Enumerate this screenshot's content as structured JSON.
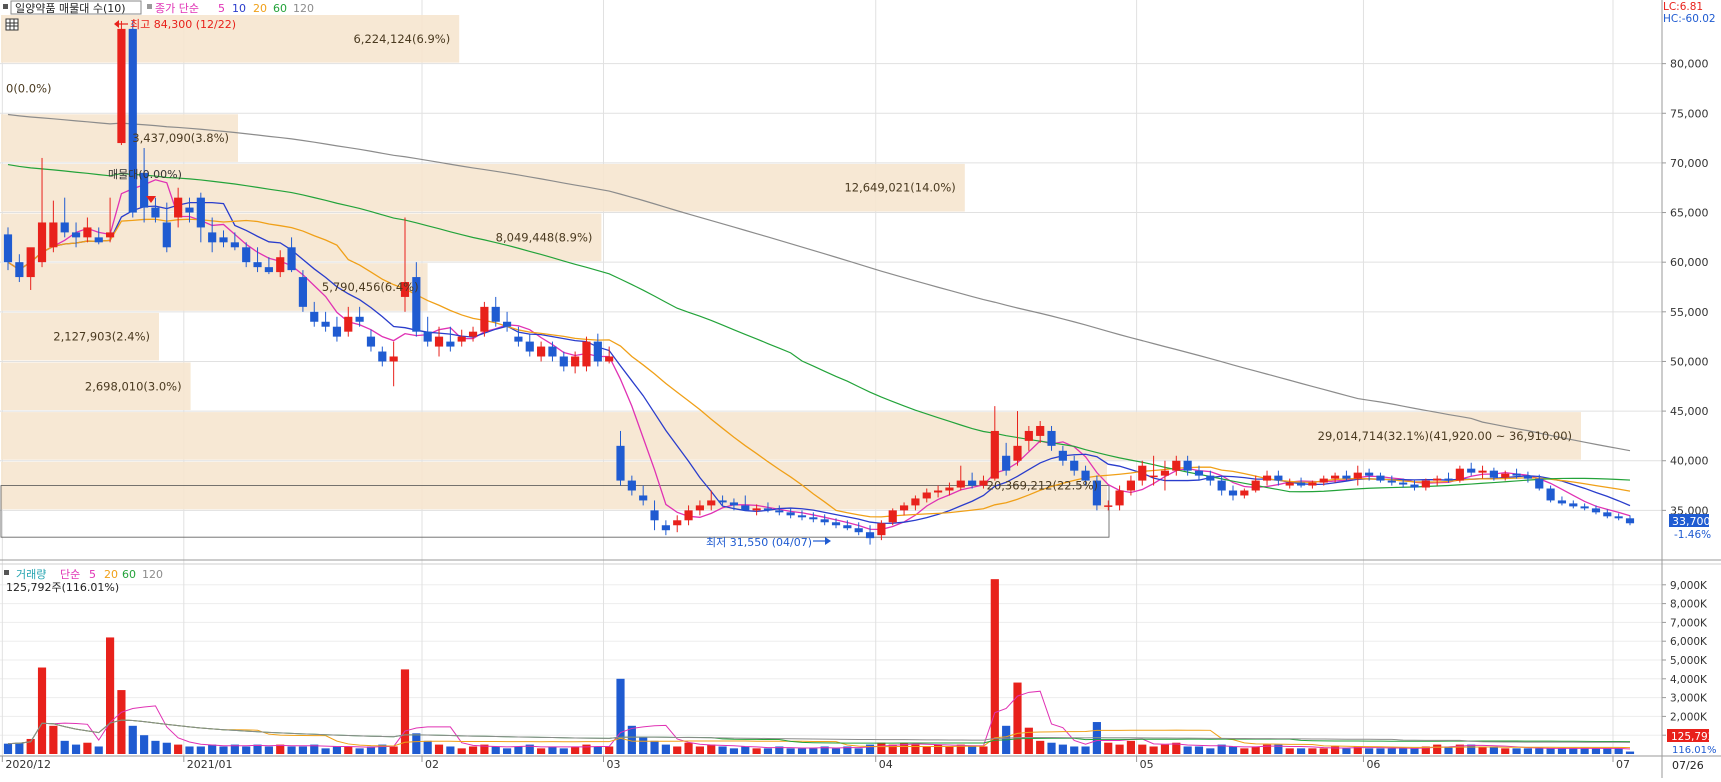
{
  "header": {
    "title": "일양약품 매물대 수(10)",
    "ma_prefix": "종가 단순",
    "ma_periods": [
      "5",
      "10",
      "20",
      "60",
      "120"
    ],
    "lc_label": "LC:6.81",
    "hc_label": "HC:-60.02"
  },
  "volume_header": {
    "title": "거래량",
    "ma_prefix": "단순",
    "ma_periods": [
      "5",
      "20",
      "60",
      "120"
    ],
    "current_value": "125,792주(116.01%)"
  },
  "colors": {
    "up": "#e8211b",
    "down": "#1f5bd1",
    "ma5": "#e032b4",
    "ma10": "#2a3dcc",
    "ma20": "#f0a018",
    "ma60": "#23a33a",
    "ma120": "#8c8c8c",
    "profile": "#f6e5cf"
  },
  "price_axis": {
    "ticks": [
      "35,000",
      "40,000",
      "45,000",
      "50,000",
      "55,000",
      "60,000",
      "65,000",
      "70,000",
      "75,000",
      "80,000"
    ],
    "current_price": "33,700",
    "change_pct": "-1.46%"
  },
  "volume_axis": {
    "ticks": [
      "1,000K",
      "2,000K",
      "3,000K",
      "4,000K",
      "5,000K",
      "6,000K",
      "7,000K",
      "8,000K",
      "9,000K"
    ],
    "current_volume": "125,792",
    "pct_label": "116.01%"
  },
  "time_axis": {
    "labels": [
      "2020/12",
      "2021/01",
      "02",
      "03",
      "04",
      "05",
      "06",
      "07"
    ],
    "last_date": "07/26"
  },
  "annotations": {
    "high": "최고 84,300 (12/22)",
    "low": "최저 31,550 (04/07)"
  },
  "chart_data": {
    "type": "candlestick",
    "title": "일양약품 매물대 수(10)",
    "price_range": [
      30000,
      85000
    ],
    "volume_range": [
      0,
      10000000
    ],
    "volume_profile": [
      {
        "label": "6,224,124(6.9%)",
        "from": 80000,
        "to": 85000
      },
      {
        "label": "0(0.0%)",
        "from": 75000,
        "to": 80000
      },
      {
        "label": "3,437,090(3.8%)",
        "from": 70000,
        "to": 75000
      },
      {
        "label": "12,649,021(14.0%)",
        "from": 65000,
        "to": 70000
      },
      {
        "label": "8,049,448(8.9%)",
        "from": 60000,
        "to": 65000
      },
      {
        "label": "5,790,456(6.4%)",
        "from": 55000,
        "to": 60000
      },
      {
        "label": "2,127,903(2.4%)",
        "from": 50000,
        "to": 55000
      },
      {
        "label": "2,698,010(3.0%)",
        "from": 45000,
        "to": 50000
      },
      {
        "label": "29,014,714(32.1%)(41,920.00 ~ 36,910.00)",
        "from": 40000,
        "to": 45000
      },
      {
        "label": "20,369,212(22.5%)",
        "from": 35000,
        "to": 40000
      }
    ],
    "profile_lengths": [
      0.29,
      0,
      0.15,
      0.61,
      0.38,
      0.27,
      0.1,
      0.12,
      1.0,
      0.7
    ],
    "mid_label": "매물대(0.00%)",
    "candles": [
      [
        62800,
        63500,
        59200,
        60000,
        0.55
      ],
      [
        60000,
        60800,
        58000,
        58500,
        0.6
      ],
      [
        58500,
        61000,
        57200,
        61500,
        0.8
      ],
      [
        60000,
        70500,
        59500,
        64000,
        4.6
      ],
      [
        61500,
        66200,
        61000,
        64000,
        1.5
      ],
      [
        64000,
        66500,
        62500,
        63000,
        0.7
      ],
      [
        63000,
        64000,
        61500,
        62500,
        0.5
      ],
      [
        62500,
        64500,
        62000,
        63500,
        0.6
      ],
      [
        62500,
        63500,
        61800,
        62000,
        0.4
      ],
      [
        62500,
        66500,
        62000,
        63000,
        6.2
      ],
      [
        72000,
        84300,
        71800,
        83500,
        3.4
      ],
      [
        83500,
        84300,
        64500,
        65000,
        1.5
      ],
      [
        69000,
        71500,
        64000,
        65500,
        1.0
      ],
      [
        65500,
        66500,
        64000,
        64500,
        0.7
      ],
      [
        64000,
        66000,
        61000,
        61500,
        0.6
      ],
      [
        64500,
        67500,
        63500,
        66500,
        0.5
      ],
      [
        65500,
        66500,
        64000,
        65000,
        0.4
      ],
      [
        66500,
        67000,
        62000,
        63500,
        0.4
      ],
      [
        63000,
        64500,
        61000,
        62000,
        0.5
      ],
      [
        62500,
        63200,
        61500,
        62000,
        0.4
      ],
      [
        62000,
        63000,
        61200,
        61500,
        0.5
      ],
      [
        61500,
        62000,
        59500,
        60000,
        0.4
      ],
      [
        60000,
        61500,
        59000,
        59500,
        0.5
      ],
      [
        59500,
        60500,
        58800,
        59000,
        0.4
      ],
      [
        59000,
        61200,
        58500,
        60500,
        0.5
      ],
      [
        61500,
        62500,
        59000,
        59200,
        0.4
      ],
      [
        58500,
        59200,
        55000,
        55500,
        0.4
      ],
      [
        55000,
        56000,
        53500,
        54000,
        0.5
      ],
      [
        54000,
        55000,
        53000,
        53500,
        0.3
      ],
      [
        53500,
        54500,
        52000,
        52500,
        0.4
      ],
      [
        53000,
        55500,
        52500,
        54500,
        0.4
      ],
      [
        54500,
        55500,
        53500,
        54000,
        0.3
      ],
      [
        52500,
        53200,
        51000,
        51500,
        0.4
      ],
      [
        51000,
        51500,
        49500,
        50000,
        0.5
      ],
      [
        50000,
        52000,
        47500,
        50500,
        0.4
      ],
      [
        56500,
        64500,
        55000,
        58000,
        4.5
      ],
      [
        58500,
        60000,
        52500,
        53000,
        1.1
      ],
      [
        53000,
        54500,
        51500,
        52000,
        0.7
      ],
      [
        51500,
        53500,
        50500,
        52500,
        0.5
      ],
      [
        52000,
        53500,
        51000,
        51500,
        0.4
      ],
      [
        52000,
        53200,
        51500,
        52500,
        0.3
      ],
      [
        52500,
        53500,
        52000,
        53000,
        0.4
      ],
      [
        53000,
        56000,
        52500,
        55500,
        0.5
      ],
      [
        55500,
        56500,
        53500,
        54000,
        0.4
      ],
      [
        54000,
        55000,
        53000,
        53500,
        0.3
      ],
      [
        52500,
        53500,
        51500,
        52000,
        0.4
      ],
      [
        52000,
        52800,
        50500,
        51000,
        0.5
      ],
      [
        50500,
        52000,
        50000,
        51500,
        0.3
      ],
      [
        51500,
        52000,
        50000,
        50500,
        0.4
      ],
      [
        50500,
        51000,
        49000,
        49500,
        0.3
      ],
      [
        49500,
        51000,
        48800,
        50500,
        0.4
      ],
      [
        49500,
        52500,
        49000,
        52000,
        0.5
      ],
      [
        52000,
        52800,
        49500,
        50000,
        0.4
      ],
      [
        50000,
        51500,
        49800,
        50500,
        0.4
      ],
      [
        41500,
        43000,
        37500,
        38000,
        4.0
      ],
      [
        38000,
        38500,
        36500,
        37000,
        1.5
      ],
      [
        36500,
        37500,
        35500,
        36000,
        0.9
      ],
      [
        35000,
        36000,
        33000,
        34000,
        0.7
      ],
      [
        33500,
        34000,
        32500,
        33000,
        0.5
      ],
      [
        33500,
        34500,
        32800,
        34000,
        0.4
      ],
      [
        34000,
        35500,
        33500,
        35000,
        0.6
      ],
      [
        35000,
        36000,
        34500,
        35500,
        0.4
      ],
      [
        35500,
        37000,
        35000,
        36000,
        0.5
      ],
      [
        36000,
        36500,
        35500,
        35800,
        0.4
      ],
      [
        35800,
        36200,
        35000,
        35500,
        0.3
      ],
      [
        35500,
        36500,
        35000,
        35000,
        0.4
      ],
      [
        35000,
        35600,
        34500,
        35200,
        0.3
      ],
      [
        35200,
        35800,
        34800,
        35000,
        0.3
      ],
      [
        35000,
        35500,
        34500,
        34800,
        0.4
      ],
      [
        34800,
        35200,
        34200,
        34500,
        0.3
      ],
      [
        34500,
        35000,
        34000,
        34300,
        0.3
      ],
      [
        34300,
        34800,
        33800,
        34100,
        0.3
      ],
      [
        34100,
        34600,
        33500,
        33800,
        0.4
      ],
      [
        33800,
        34200,
        33200,
        33500,
        0.3
      ],
      [
        33500,
        34000,
        33000,
        33200,
        0.4
      ],
      [
        33200,
        33800,
        32500,
        32800,
        0.3
      ],
      [
        32800,
        33500,
        31550,
        32200,
        0.5
      ],
      [
        32500,
        34000,
        32000,
        33700,
        0.6
      ],
      [
        33800,
        35200,
        33500,
        35000,
        0.5
      ],
      [
        35000,
        35800,
        34500,
        35500,
        0.6
      ],
      [
        35500,
        36500,
        35000,
        36200,
        0.5
      ],
      [
        36200,
        37200,
        35800,
        36800,
        0.4
      ],
      [
        36800,
        37500,
        36300,
        37000,
        0.5
      ],
      [
        37000,
        37800,
        36500,
        37300,
        0.4
      ],
      [
        37300,
        39500,
        37000,
        38000,
        0.5
      ],
      [
        38000,
        38800,
        37200,
        37500,
        0.4
      ],
      [
        37500,
        38500,
        37200,
        38000,
        0.4
      ],
      [
        38200,
        45500,
        38000,
        43000,
        9.3
      ],
      [
        40500,
        41800,
        38500,
        39000,
        1.5
      ],
      [
        40000,
        45000,
        39500,
        41500,
        3.8
      ],
      [
        42000,
        43500,
        41000,
        43000,
        1.4
      ],
      [
        42500,
        44000,
        41800,
        43500,
        0.7
      ],
      [
        43000,
        43500,
        41000,
        41500,
        0.6
      ],
      [
        41000,
        41500,
        39500,
        40000,
        0.5
      ],
      [
        40000,
        40500,
        38500,
        39000,
        0.4
      ],
      [
        39000,
        39500,
        37500,
        38000,
        0.4
      ],
      [
        38000,
        38500,
        35000,
        35500,
        1.7
      ],
      [
        35500,
        36000,
        35000,
        35500,
        0.6
      ],
      [
        35500,
        37500,
        35000,
        37000,
        0.5
      ],
      [
        37000,
        38500,
        36500,
        38000,
        0.7
      ],
      [
        38000,
        40000,
        37500,
        39500,
        0.5
      ],
      [
        38500,
        40500,
        37500,
        38500,
        0.4
      ],
      [
        38500,
        40000,
        37000,
        39000,
        0.5
      ],
      [
        39000,
        40500,
        38500,
        40000,
        0.6
      ],
      [
        40000,
        40500,
        38500,
        39000,
        0.4
      ],
      [
        39000,
        39500,
        38000,
        38500,
        0.4
      ],
      [
        38500,
        39000,
        37500,
        38000,
        0.3
      ],
      [
        38000,
        38500,
        36500,
        37000,
        0.5
      ],
      [
        37000,
        37500,
        36000,
        36500,
        0.4
      ],
      [
        36500,
        37200,
        36200,
        37000,
        0.3
      ],
      [
        37000,
        38500,
        36800,
        38000,
        0.4
      ],
      [
        38000,
        39000,
        37500,
        38500,
        0.5
      ],
      [
        38500,
        39000,
        37500,
        38000,
        0.5
      ],
      [
        37500,
        38200,
        37200,
        37800,
        0.3
      ],
      [
        37800,
        38300,
        37300,
        37500,
        0.3
      ],
      [
        37500,
        38000,
        37200,
        37800,
        0.3
      ],
      [
        37800,
        38500,
        37500,
        38200,
        0.3
      ],
      [
        38200,
        38800,
        37800,
        38500,
        0.4
      ],
      [
        38500,
        39000,
        38000,
        38200,
        0.3
      ],
      [
        38200,
        39500,
        37500,
        38800,
        0.4
      ],
      [
        38800,
        39200,
        38000,
        38500,
        0.3
      ],
      [
        38500,
        38800,
        37800,
        38000,
        0.3
      ],
      [
        38000,
        38500,
        37500,
        37800,
        0.3
      ],
      [
        37800,
        38200,
        37300,
        37600,
        0.3
      ],
      [
        37600,
        38000,
        37000,
        37300,
        0.3
      ],
      [
        37300,
        38200,
        37000,
        38000,
        0.4
      ],
      [
        38000,
        38500,
        37500,
        38200,
        0.5
      ],
      [
        38200,
        38800,
        37800,
        38000,
        0.4
      ],
      [
        38000,
        39500,
        37800,
        39200,
        0.5
      ],
      [
        39200,
        39800,
        38500,
        38800,
        0.5
      ],
      [
        38800,
        39500,
        38200,
        39000,
        0.4
      ],
      [
        39000,
        39300,
        38000,
        38300,
        0.4
      ],
      [
        38300,
        39000,
        38000,
        38700,
        0.3
      ],
      [
        38700,
        39200,
        38200,
        38500,
        0.3
      ],
      [
        38500,
        38900,
        37800,
        38200,
        0.3
      ],
      [
        38200,
        38600,
        37000,
        37200,
        0.3
      ],
      [
        37200,
        37500,
        35800,
        36000,
        0.3
      ],
      [
        36000,
        36400,
        35500,
        35700,
        0.3
      ],
      [
        35700,
        36000,
        35200,
        35400,
        0.3
      ],
      [
        35400,
        35700,
        35000,
        35200,
        0.3
      ],
      [
        35200,
        35500,
        34600,
        34800,
        0.3
      ],
      [
        34800,
        35100,
        34200,
        34400,
        0.3
      ],
      [
        34400,
        34700,
        34000,
        34200,
        0.3
      ],
      [
        34200,
        34500,
        33500,
        33700,
        0.13
      ]
    ]
  }
}
